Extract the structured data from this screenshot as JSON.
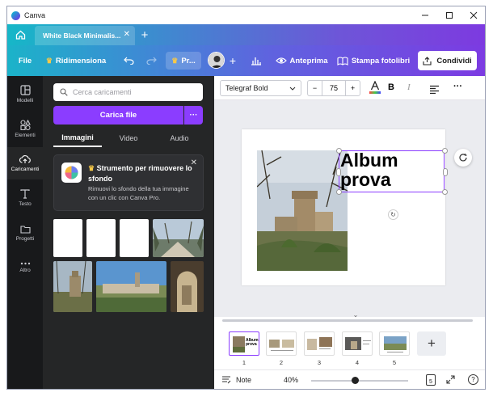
{
  "window": {
    "app_title": "Canva"
  },
  "tabs": [
    {
      "label": "White Black Minimalis..."
    }
  ],
  "toolbar": {
    "file": "File",
    "resize": "Ridimensiona",
    "pro_label": "Pr...",
    "preview": "Anteprima",
    "print": "Stampa fotolibri",
    "share": "Condividi"
  },
  "rail": [
    {
      "label": "Modelli",
      "icon": "template-icon"
    },
    {
      "label": "Elementi",
      "icon": "elements-icon"
    },
    {
      "label": "Caricamenti",
      "icon": "upload-cloud-icon"
    },
    {
      "label": "Testo",
      "icon": "text-icon"
    },
    {
      "label": "Progetti",
      "icon": "folder-icon"
    },
    {
      "label": "Altro",
      "icon": "more-icon"
    }
  ],
  "panel": {
    "search_placeholder": "Cerca caricamenti",
    "upload_button": "Carica file",
    "tabs": [
      "Immagini",
      "Video",
      "Audio"
    ],
    "promo_title": "Strumento per rimuovere lo sfondo",
    "promo_desc": "Rimuovi lo sfondo della tua immagine con un clic con Canva Pro."
  },
  "editor": {
    "font": "Telegraf Bold",
    "font_size": "75",
    "text_content_line1": "Album",
    "text_content_line2": "prova"
  },
  "pages": [
    "1",
    "2",
    "3",
    "4",
    "5"
  ],
  "footer": {
    "notes": "Note",
    "zoom": "40%",
    "page_count": "5",
    "zoom_level": 0.45
  },
  "colors": {
    "accent": "#8b3dff",
    "rail_bg": "#18191b",
    "panel_bg": "#252627"
  }
}
